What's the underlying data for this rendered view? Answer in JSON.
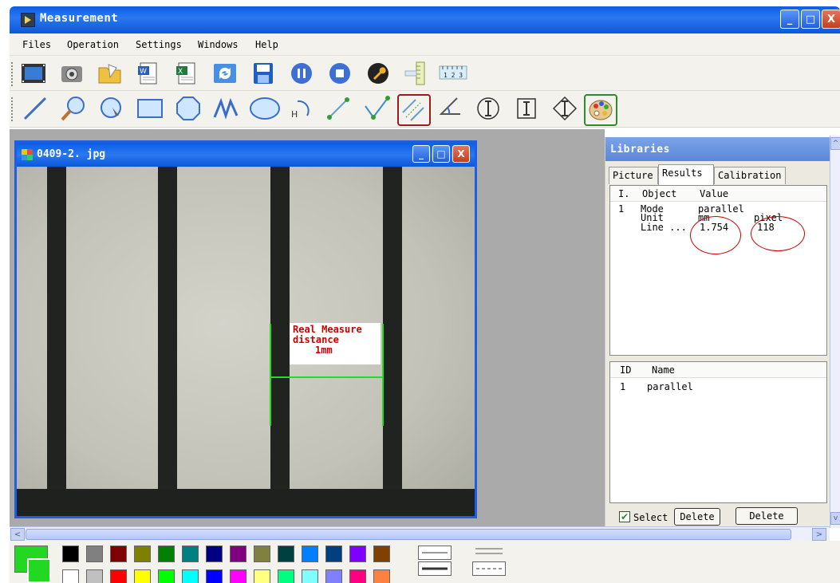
{
  "window": {
    "title": "Measurement",
    "minimize": "_",
    "maximize": "□",
    "close": "X"
  },
  "menu": [
    "Files",
    "Operation",
    "Settings",
    "Windows",
    "Help"
  ],
  "toolbar_row1_icons": [
    "filmstrip-icon",
    "camera-icon",
    "open-folder-icon",
    "word-export-icon",
    "excel-export-icon",
    "refresh-icon",
    "save-icon",
    "pause-icon",
    "stop-icon",
    "settings-wrench-icon",
    "vertical-ruler-icon",
    "horizontal-ruler-icon"
  ],
  "toolbar_row1_ruler_text": "1 2 3",
  "toolbar_row2_icons": [
    "line-tool-icon",
    "magnifier-tool-icon",
    "circle-select-icon",
    "rectangle-tool-icon",
    "polygon-tool-icon",
    "curve-tool-icon",
    "ellipse-tool-icon",
    "arc-h-tool-icon",
    "distance-tool-icon",
    "angle-check-tool-icon",
    "parallel-line-tool-icon",
    "angle-tool-icon",
    "vertical-dimension-icon",
    "box-dimension-icon",
    "diamond-dimension-icon",
    "color-palette-icon"
  ],
  "toolbar_row2_arc_label": "H",
  "image_window": {
    "title": "0409-2. jpg",
    "annotation": [
      "Real Measure",
      "distance",
      "1mm"
    ]
  },
  "libraries": {
    "title": "Libraries",
    "tabs": [
      "Picture",
      "Results",
      "Calibration"
    ],
    "active_tab": "Results",
    "results": {
      "headers": [
        "I.",
        "Object",
        "Value"
      ],
      "rows": [
        {
          "id": "1",
          "object": "Mode",
          "value": "parallel",
          "extra": ""
        },
        {
          "id": "",
          "object": "Unit",
          "value": "mm",
          "extra": "pixel"
        },
        {
          "id": "",
          "object": "Line ...",
          "value": "1.754",
          "extra": "118"
        }
      ]
    },
    "names": {
      "headers": [
        "ID",
        "Name"
      ],
      "rows": [
        {
          "id": "1",
          "name": "parallel"
        }
      ]
    },
    "select_label": "Select",
    "select_checked": "✔",
    "delete_label_1": "Delete",
    "delete_label_2": "Delete"
  },
  "scroll": {
    "left": "<",
    "right": ">",
    "up": "^",
    "down": "v"
  },
  "palette": {
    "current_color": "#22d822",
    "row1": [
      "#000000",
      "#808080",
      "#800000",
      "#808000",
      "#008000",
      "#008080",
      "#000080",
      "#800080",
      "#808040",
      "#004040",
      "#0080ff",
      "#004080",
      "#8000ff",
      "#804000"
    ],
    "row2": [
      "#ffffff",
      "#c0c0c0",
      "#ff0000",
      "#ffff00",
      "#00ff00",
      "#00ffff",
      "#0000ff",
      "#ff00ff",
      "#ffff80",
      "#00ff80",
      "#80ffff",
      "#8080ff",
      "#ff0080",
      "#ff8040"
    ]
  }
}
